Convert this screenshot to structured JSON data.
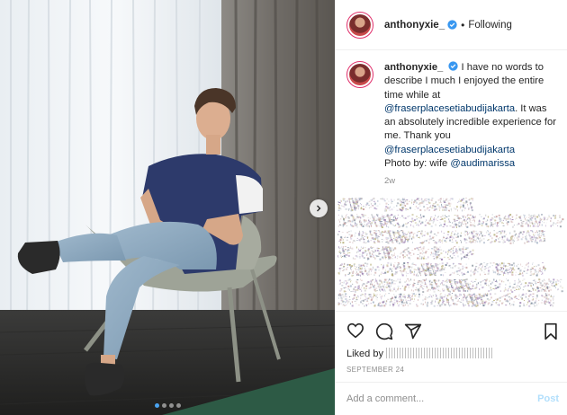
{
  "header": {
    "username": "anthonyxie_",
    "separator": "•",
    "follow_status": "Following",
    "verified_icon": "verified-badge-icon"
  },
  "caption": {
    "username": "anthonyxie_",
    "text_1": "I have no words to describe I much I enjoyed the entire time while at",
    "mention_1": "@fraserplacesetiabudijakarta",
    "text_2": ". It was an absolutely incredible experience for me. Thank you",
    "mention_2": "@fraserplacesetiabudijakarta",
    "text_3": "Photo by: wife",
    "mention_3": "@audimarissa",
    "timestamp": "2w"
  },
  "photo": {
    "carousel_position": 1,
    "carousel_count": 4
  },
  "actions": {
    "liked_prefix": "Liked by",
    "date": "SEPTEMBER 24",
    "icons": [
      "heart-icon",
      "comment-icon",
      "share-icon",
      "bookmark-icon"
    ]
  },
  "comment_box": {
    "placeholder": "Add a comment...",
    "post_label": "Post"
  },
  "colors": {
    "link": "#00376b",
    "verified": "#3897f0",
    "post_disabled": "#b2dffc",
    "muted": "#8e8e8e"
  }
}
